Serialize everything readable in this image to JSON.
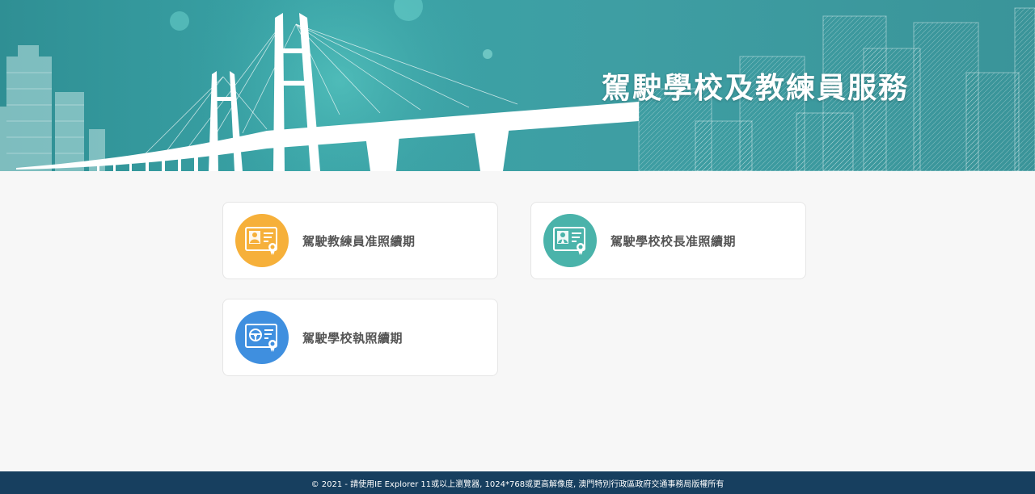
{
  "banner": {
    "title": "駕駛學校及教練員服務"
  },
  "services": [
    {
      "label": "駕駛教練員准照續期",
      "icon": "instructor-license-icon",
      "color": "#f6b03a"
    },
    {
      "label": "駕駛學校校長准照續期",
      "icon": "principal-license-icon",
      "color": "#4ab3aa"
    },
    {
      "label": "駕駛學校執照續期",
      "icon": "school-license-icon",
      "color": "#3f8fdf"
    }
  ],
  "footer": {
    "text": "© 2021 - 請使用IE Explorer 11或以上瀏覽器, 1024*768或更高解像度, 澳門特別行政區政府交通事務局版權所有"
  }
}
